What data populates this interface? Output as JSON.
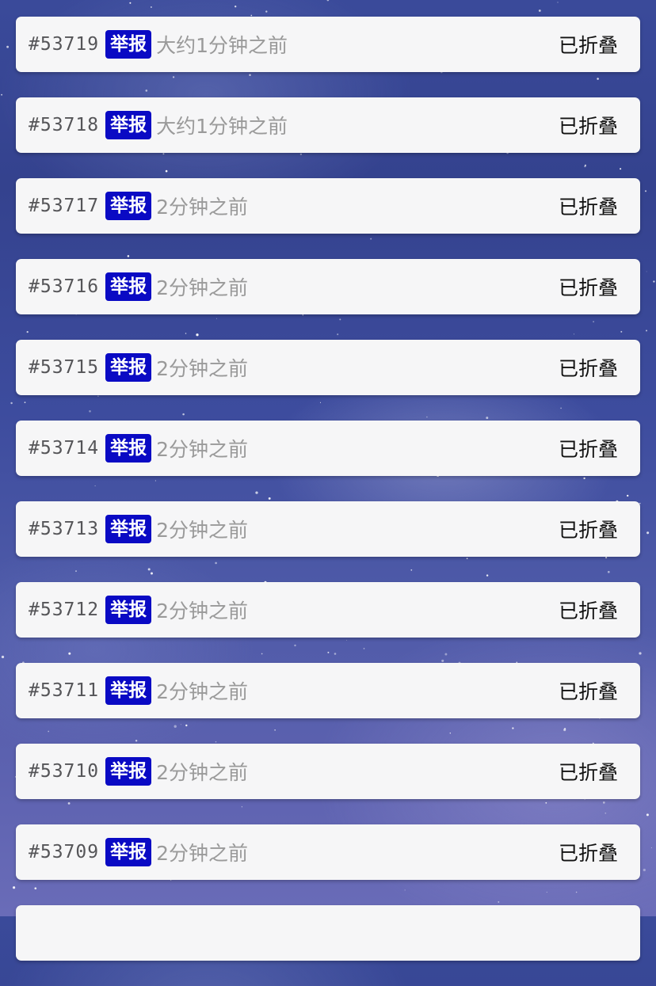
{
  "report_label": "举报",
  "status_label": "已折叠",
  "items": [
    {
      "id": "#53719",
      "time": "大约1分钟之前"
    },
    {
      "id": "#53718",
      "time": "大约1分钟之前"
    },
    {
      "id": "#53717",
      "time": "2分钟之前"
    },
    {
      "id": "#53716",
      "time": "2分钟之前"
    },
    {
      "id": "#53715",
      "time": "2分钟之前"
    },
    {
      "id": "#53714",
      "time": "2分钟之前"
    },
    {
      "id": "#53713",
      "time": "2分钟之前"
    },
    {
      "id": "#53712",
      "time": "2分钟之前"
    },
    {
      "id": "#53711",
      "time": "2分钟之前"
    },
    {
      "id": "#53710",
      "time": "2分钟之前"
    },
    {
      "id": "#53709",
      "time": "2分钟之前"
    },
    {
      "id": "",
      "time": ""
    }
  ],
  "colors": {
    "report_badge": "#0a0ac4",
    "card_background": "#f6f6f7",
    "time_text": "#9a9a9a"
  }
}
